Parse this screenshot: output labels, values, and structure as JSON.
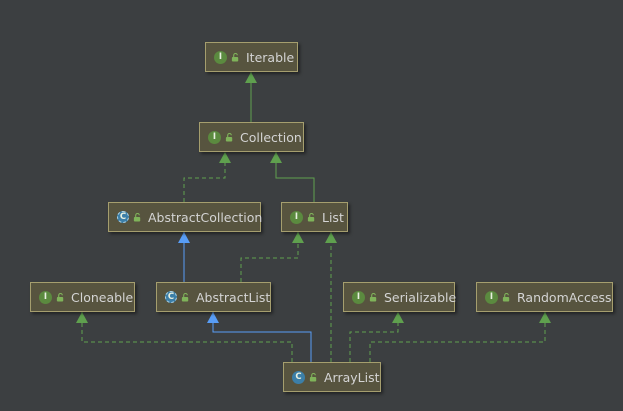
{
  "colors": {
    "background": "#3c3f41",
    "node_fill": "#57543f",
    "node_border": "#a59e6e",
    "interface_edge": "#5fa04e",
    "extends_edge": "#589df6",
    "interface_badge": "#5b8a3f",
    "class_badge": "#3c7fa8"
  },
  "nodes": {
    "iterable": {
      "label": "Iterable",
      "kind": "interface",
      "badge": "I",
      "icon": "interface-icon"
    },
    "collection": {
      "label": "Collection",
      "kind": "interface",
      "badge": "I",
      "icon": "interface-icon"
    },
    "abstract_collection": {
      "label": "AbstractCollection",
      "kind": "abstract-class",
      "badge": "C",
      "icon": "abstract-class-icon"
    },
    "list": {
      "label": "List",
      "kind": "interface",
      "badge": "I",
      "icon": "interface-icon"
    },
    "cloneable": {
      "label": "Cloneable",
      "kind": "interface",
      "badge": "I",
      "icon": "interface-icon"
    },
    "abstract_list": {
      "label": "AbstractList",
      "kind": "abstract-class",
      "badge": "C",
      "icon": "abstract-class-icon"
    },
    "serializable": {
      "label": "Serializable",
      "kind": "interface",
      "badge": "I",
      "icon": "interface-icon"
    },
    "random_access": {
      "label": "RandomAccess",
      "kind": "interface",
      "badge": "I",
      "icon": "interface-icon"
    },
    "array_list": {
      "label": "ArrayList",
      "kind": "class",
      "badge": "C",
      "icon": "class-icon"
    }
  },
  "edges": [
    {
      "from": "collection",
      "to": "iterable",
      "type": "extends-interface"
    },
    {
      "from": "abstract_collection",
      "to": "collection",
      "type": "implements"
    },
    {
      "from": "list",
      "to": "collection",
      "type": "extends-interface"
    },
    {
      "from": "abstract_list",
      "to": "abstract_collection",
      "type": "extends"
    },
    {
      "from": "abstract_list",
      "to": "list",
      "type": "implements"
    },
    {
      "from": "array_list",
      "to": "abstract_list",
      "type": "extends"
    },
    {
      "from": "array_list",
      "to": "list",
      "type": "implements"
    },
    {
      "from": "array_list",
      "to": "cloneable",
      "type": "implements"
    },
    {
      "from": "array_list",
      "to": "serializable",
      "type": "implements"
    },
    {
      "from": "array_list",
      "to": "random_access",
      "type": "implements"
    }
  ]
}
